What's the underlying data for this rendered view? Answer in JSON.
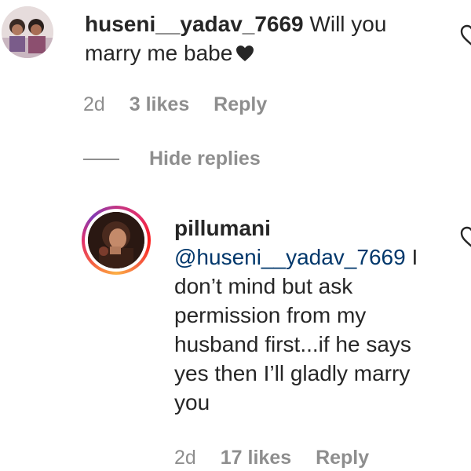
{
  "comment": {
    "username": "huseni__yadav_7669",
    "text": "Will you marry me babe",
    "time": "2d",
    "likes": "3 likes",
    "reply_label": "Reply"
  },
  "hide_replies_label": "Hide replies",
  "reply": {
    "username": "pillumani",
    "mention": "@huseni__yadav_7669",
    "text": "I don’t mind but ask permission from my husband first...if he says yes then I’ll gladly marry you",
    "time": "2d",
    "likes": "17 likes",
    "reply_label": "Reply"
  },
  "icons": {
    "inline_heart": "black-heart-icon",
    "like": "heart-outline-icon"
  },
  "colors": {
    "text": "#262626",
    "meta": "#8e8e8e",
    "mention": "#00376b"
  }
}
